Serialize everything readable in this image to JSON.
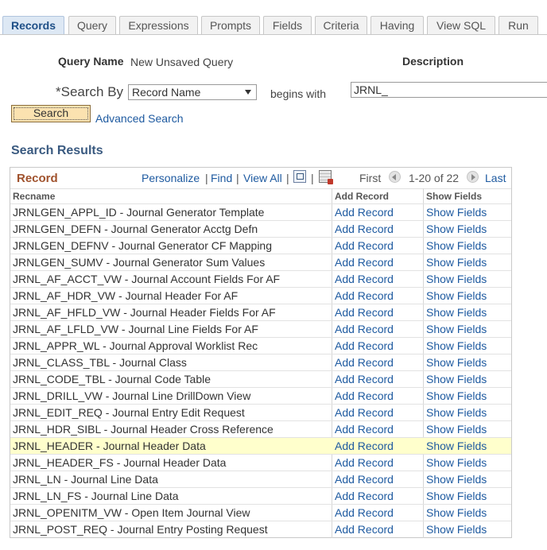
{
  "tabs": [
    "Records",
    "Query",
    "Expressions",
    "Prompts",
    "Fields",
    "Criteria",
    "Having",
    "View SQL",
    "Run"
  ],
  "active_tab": "Records",
  "form": {
    "query_name_label": "Query Name",
    "query_name_value": "New Unsaved Query",
    "description_label": "Description",
    "search_by_label": "*Search By",
    "search_by_value": "Record Name",
    "operator": "begins with",
    "search_value": "JRNL_",
    "search_button": "Search",
    "advanced_search": "Advanced Search"
  },
  "results": {
    "title": "Search Results",
    "grid_title": "Record",
    "personalize": "Personalize",
    "find": "Find",
    "view_all": "View All",
    "first": "First",
    "range": "1-20 of 22",
    "last": "Last",
    "columns": [
      "Recname",
      "Add Record",
      "Show Fields"
    ],
    "rows": [
      {
        "name": "JRNLGEN_APPL_ID - Journal Generator Template",
        "add": "Add Record",
        "show": "Show Fields"
      },
      {
        "name": "JRNLGEN_DEFN - Journal Generator Acctg Defn",
        "add": "Add Record",
        "show": "Show Fields"
      },
      {
        "name": "JRNLGEN_DEFNV - Journal Generator CF Mapping",
        "add": "Add Record",
        "show": "Show Fields"
      },
      {
        "name": "JRNLGEN_SUMV - Journal Generator Sum Values",
        "add": "Add Record",
        "show": "Show Fields"
      },
      {
        "name": "JRNL_AF_ACCT_VW - Journal Account Fields For AF",
        "add": "Add Record",
        "show": "Show Fields"
      },
      {
        "name": "JRNL_AF_HDR_VW - Journal Header For AF",
        "add": "Add Record",
        "show": "Show Fields"
      },
      {
        "name": "JRNL_AF_HFLD_VW - Journal Header Fields For AF",
        "add": "Add Record",
        "show": "Show Fields"
      },
      {
        "name": "JRNL_AF_LFLD_VW - Journal Line Fields For AF",
        "add": "Add Record",
        "show": "Show Fields"
      },
      {
        "name": "JRNL_APPR_WL - Journal Approval Worklist Rec",
        "add": "Add Record",
        "show": "Show Fields"
      },
      {
        "name": "JRNL_CLASS_TBL - Journal Class",
        "add": "Add Record",
        "show": "Show Fields"
      },
      {
        "name": "JRNL_CODE_TBL - Journal Code Table",
        "add": "Add Record",
        "show": "Show Fields"
      },
      {
        "name": "JRNL_DRILL_VW - Journal Line DrillDown View",
        "add": "Add Record",
        "show": "Show Fields"
      },
      {
        "name": "JRNL_EDIT_REQ - Journal Entry Edit Request",
        "add": "Add Record",
        "show": "Show Fields"
      },
      {
        "name": "JRNL_HDR_SIBL - Journal Header Cross Reference",
        "add": "Add Record",
        "show": "Show Fields"
      },
      {
        "name": "JRNL_HEADER - Journal Header Data",
        "add": "Add Record",
        "show": "Show Fields"
      },
      {
        "name": "JRNL_HEADER_FS - Journal Header Data",
        "add": "Add Record",
        "show": "Show Fields"
      },
      {
        "name": "JRNL_LN - Journal Line Data",
        "add": "Add Record",
        "show": "Show Fields"
      },
      {
        "name": "JRNL_LN_FS - Journal Line Data",
        "add": "Add Record",
        "show": "Show Fields"
      },
      {
        "name": "JRNL_OPENITM_VW - Open Item Journal View",
        "add": "Add Record",
        "show": "Show Fields"
      },
      {
        "name": "JRNL_POST_REQ - Journal Entry Posting Request",
        "add": "Add Record",
        "show": "Show Fields"
      }
    ],
    "highlighted_row": "JRNL_HEADER - Journal Header Data"
  },
  "icons": [
    "zoom-icon",
    "download-icon",
    "prev-arrow-icon",
    "next-arrow-icon",
    "dropdown-caret-icon"
  ]
}
